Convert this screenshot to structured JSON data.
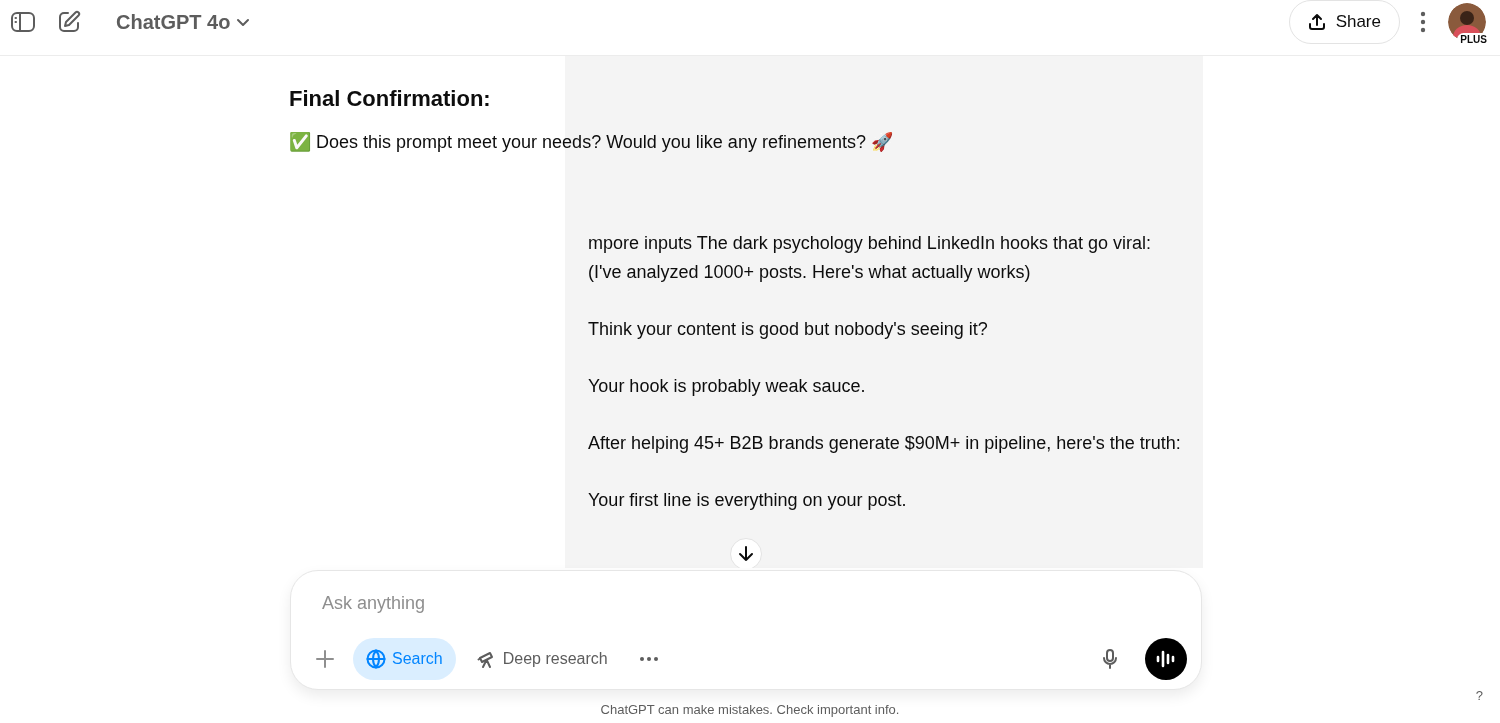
{
  "header": {
    "model": "ChatGPT 4o",
    "share": "Share",
    "plan_badge": "PLUS"
  },
  "assistant": {
    "heading": "Final Confirmation:",
    "message": "✅ Does this prompt meet your needs? Would you like any refinements? 🚀"
  },
  "user_message": {
    "paragraphs": [
      "mpore inputs The dark psychology behind LinkedIn hooks that go viral:\n(I've analyzed 1000+ posts. Here's what actually works)",
      "Think your content is good but nobody's seeing it?",
      "Your hook is probably weak sauce.",
      "After helping 45+ B2B brands generate $90M+ in pipeline, here's the truth:",
      "Your first line is everything on your post."
    ]
  },
  "composer": {
    "placeholder": "Ask anything",
    "tools": [
      {
        "kind": "search",
        "label": "Search",
        "selected": true
      },
      {
        "kind": "research",
        "label": "Deep research",
        "selected": false
      }
    ]
  },
  "disclaimer": "ChatGPT can make mistakes. Check important info.",
  "help": "?"
}
